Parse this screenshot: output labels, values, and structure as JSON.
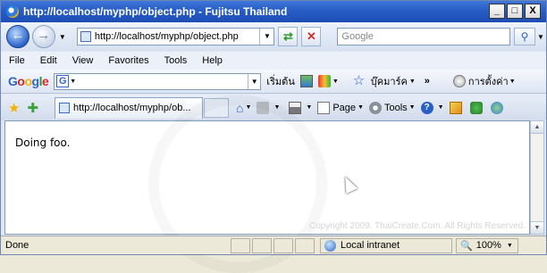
{
  "window": {
    "title": "http://localhost/myphp/object.php - Fujitsu Thailand",
    "minimize_glyph": "_",
    "maximize_glyph": "□",
    "close_glyph": "X"
  },
  "address_bar": {
    "back_glyph": "←",
    "forward_glyph": "→",
    "url": "http://localhost/myphp/object.php",
    "search_placeholder": "Google"
  },
  "menu": {
    "items": [
      "File",
      "Edit",
      "View",
      "Favorites",
      "Tools",
      "Help"
    ]
  },
  "google_toolbar": {
    "logo_letters": [
      "G",
      "o",
      "o",
      "g",
      "l",
      "e"
    ],
    "logo_colors": [
      "#3366cc",
      "#d1272a",
      "#f2b400",
      "#3366cc",
      "#2a9a3b",
      "#d1272a"
    ],
    "search_button": "เริ่มต้น",
    "bookmarks": "บุ๊คมาร์ค",
    "more": "»",
    "settings": "การตั้งค่า"
  },
  "tab": {
    "label": "http://localhost/myphp/ob..."
  },
  "commands": {
    "page": "Page",
    "tools": "Tools"
  },
  "content": {
    "text": "Doing foo.",
    "copyright": "Copyright 2009. ThaiCreate.Com. All Rights Reserved."
  },
  "status_bar": {
    "status": "Done",
    "zone": "Local intranet",
    "zoom": "100%"
  }
}
